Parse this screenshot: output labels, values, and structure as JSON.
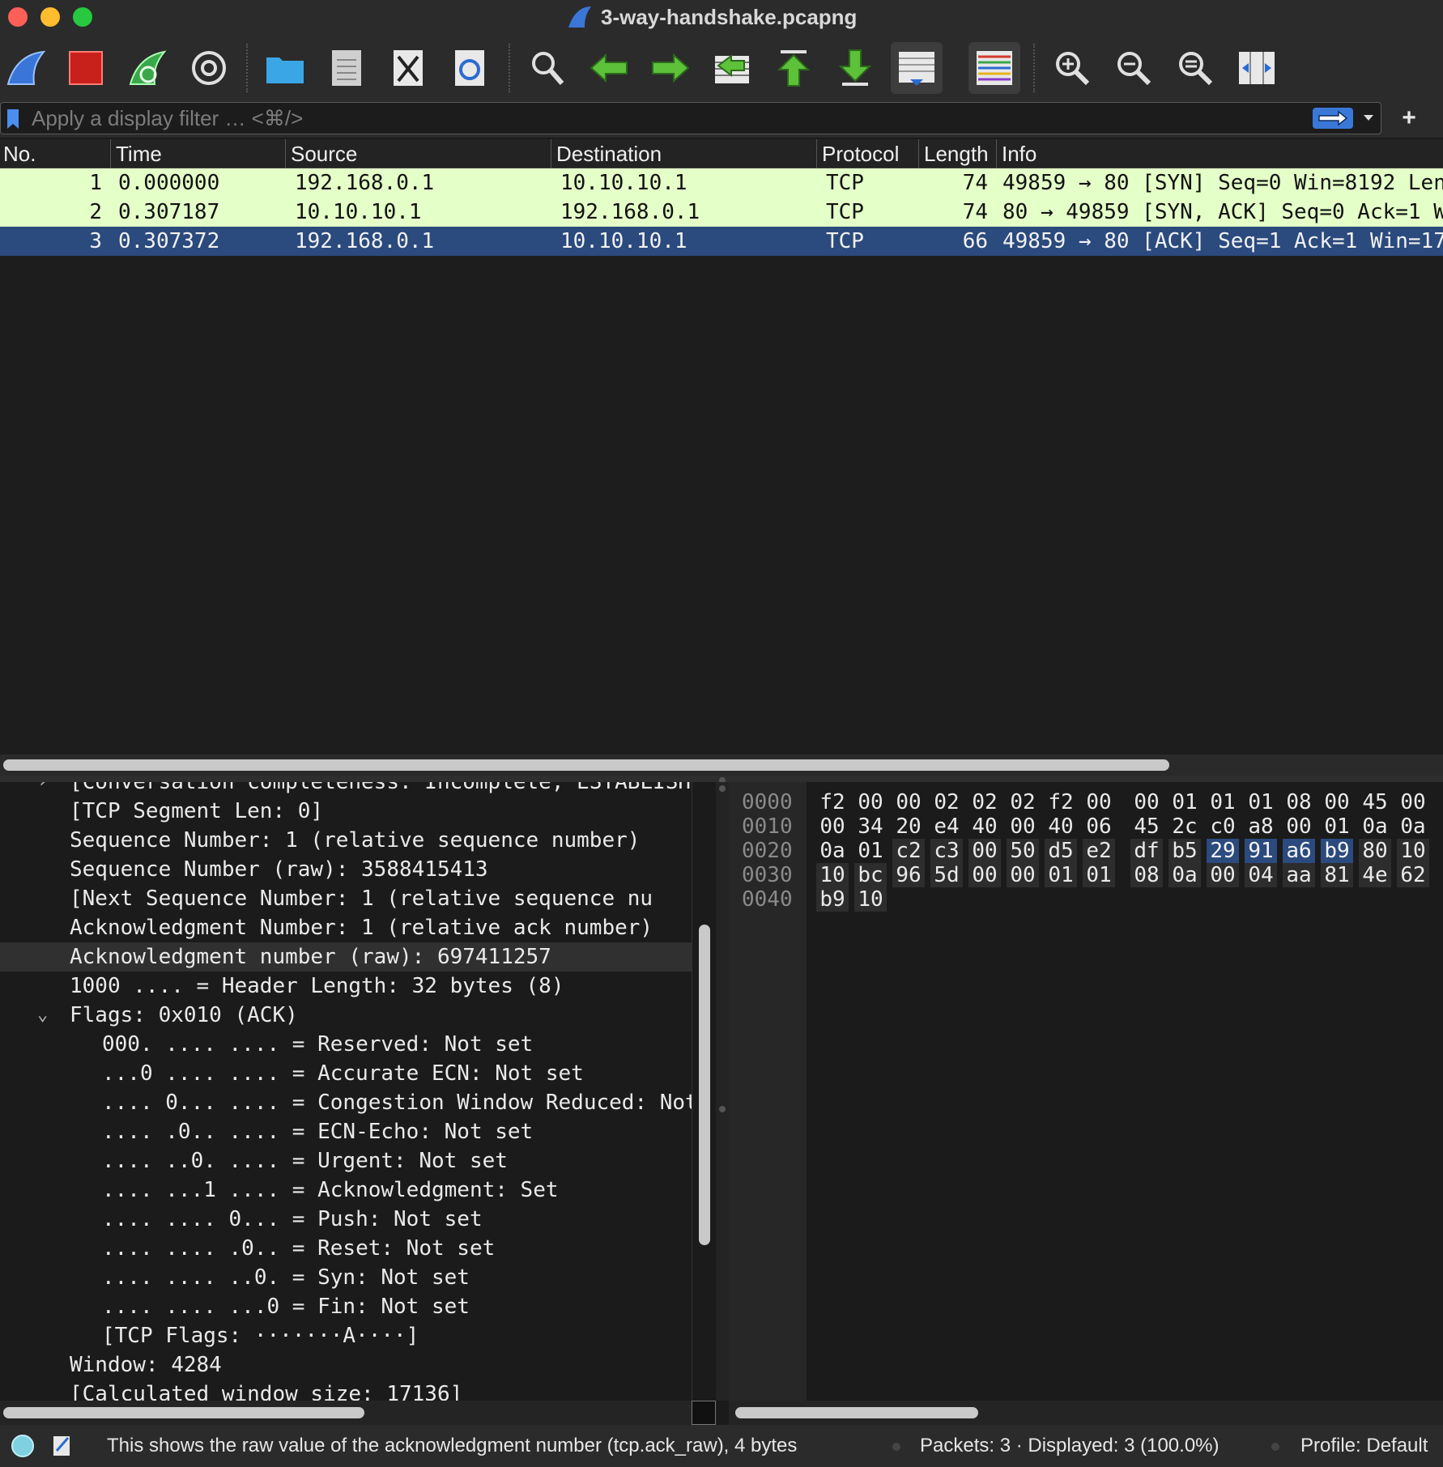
{
  "window": {
    "title": "3-way-handshake.pcapng",
    "traffic_colors": [
      "#fe5f57",
      "#febc2e",
      "#28c840"
    ]
  },
  "toolbar": {
    "buttons": [
      {
        "name": "start-capture",
        "icon": "shark-fin-icon"
      },
      {
        "name": "stop-capture",
        "icon": "stop-square-icon"
      },
      {
        "name": "restart-capture",
        "icon": "restart-fin-icon"
      },
      {
        "name": "capture-options",
        "icon": "gear-icon"
      },
      {
        "name": "open-file",
        "icon": "folder-icon"
      },
      {
        "name": "save-file",
        "icon": "binary-file-icon"
      },
      {
        "name": "close-file",
        "icon": "close-file-icon"
      },
      {
        "name": "reload-file",
        "icon": "reload-file-icon"
      },
      {
        "name": "find-packet",
        "icon": "magnifier-icon"
      },
      {
        "name": "go-back",
        "icon": "arrow-left-icon"
      },
      {
        "name": "go-forward",
        "icon": "arrow-right-icon"
      },
      {
        "name": "go-to-packet",
        "icon": "goto-packet-icon"
      },
      {
        "name": "go-first-packet",
        "icon": "arrow-up-bar-icon"
      },
      {
        "name": "go-last-packet",
        "icon": "arrow-down-bar-icon"
      },
      {
        "name": "auto-scroll",
        "icon": "auto-scroll-icon"
      },
      {
        "name": "colorize",
        "icon": "colorize-lines-icon"
      },
      {
        "name": "zoom-in",
        "icon": "zoom-in-icon"
      },
      {
        "name": "zoom-out",
        "icon": "zoom-out-icon"
      },
      {
        "name": "normal-size",
        "icon": "zoom-reset-icon"
      },
      {
        "name": "resize-columns",
        "icon": "resize-columns-icon"
      }
    ]
  },
  "filter": {
    "placeholder": "Apply a display filter … <⌘/>",
    "value": "",
    "plus_label": "+"
  },
  "packet_list": {
    "columns": [
      "No.",
      "Time",
      "Source",
      "Destination",
      "Protocol",
      "Length",
      "Info"
    ],
    "rows": [
      {
        "no": "1",
        "time": "0.000000",
        "source": "192.168.0.1",
        "destination": "10.10.10.1",
        "protocol": "TCP",
        "length": "74",
        "info": "49859 → 80 [SYN] Seq=0 Win=8192 Len"
      },
      {
        "no": "2",
        "time": "0.307187",
        "source": "10.10.10.1",
        "destination": "192.168.0.1",
        "protocol": "TCP",
        "length": "74",
        "info": "80 → 49859 [SYN, ACK] Seq=0 Ack=1 W"
      },
      {
        "no": "3",
        "time": "0.307372",
        "source": "192.168.0.1",
        "destination": "10.10.10.1",
        "protocol": "TCP",
        "length": "66",
        "info": "49859 → 80 [ACK] Seq=1 Ack=1 Win=17"
      }
    ],
    "selected_row": 3,
    "tcp_row_color": "#e4ffc7",
    "selected_color": "#2b4a7e"
  },
  "details": {
    "lines": [
      {
        "text": "[Conversation completeness: Incomplete, ESTABLISH",
        "indent": 1,
        "expander": "›"
      },
      {
        "text": "[TCP Segment Len: 0]",
        "indent": 1
      },
      {
        "text": "Sequence Number: 1    (relative sequence number)",
        "indent": 1
      },
      {
        "text": "Sequence Number (raw): 3588415413",
        "indent": 1
      },
      {
        "text": "[Next Sequence Number: 1    (relative sequence nu",
        "indent": 1
      },
      {
        "text": "Acknowledgment Number: 1    (relative ack number)",
        "indent": 1
      },
      {
        "text": "Acknowledgment number (raw): 697411257",
        "indent": 1,
        "selected": true
      },
      {
        "text": "1000 .... = Header Length: 32 bytes (8)",
        "indent": 1
      },
      {
        "text": "Flags: 0x010 (ACK)",
        "indent": 1,
        "expander": "⌄"
      },
      {
        "text": "000. .... .... = Reserved: Not set",
        "indent": 2
      },
      {
        "text": "...0 .... .... = Accurate ECN: Not set",
        "indent": 2
      },
      {
        "text": ".... 0... .... = Congestion Window Reduced: Not",
        "indent": 2
      },
      {
        "text": ".... .0.. .... = ECN-Echo: Not set",
        "indent": 2
      },
      {
        "text": ".... ..0. .... = Urgent: Not set",
        "indent": 2
      },
      {
        "text": ".... ...1 .... = Acknowledgment: Set",
        "indent": 2
      },
      {
        "text": ".... .... 0... = Push: Not set",
        "indent": 2
      },
      {
        "text": ".... .... .0.. = Reset: Not set",
        "indent": 2
      },
      {
        "text": ".... .... ..0. = Syn: Not set",
        "indent": 2
      },
      {
        "text": ".... .... ...0 = Fin: Not set",
        "indent": 2
      },
      {
        "text": "[TCP Flags: ·······A····]",
        "indent": 2
      },
      {
        "text": "Window: 4284",
        "indent": 1
      },
      {
        "text": "[Calculated window size: 17136]",
        "indent": 1
      }
    ]
  },
  "bytes": {
    "rows": [
      {
        "offset": "0000",
        "hex": [
          "f2",
          "00",
          "00",
          "02",
          "02",
          "02",
          "f2",
          "00",
          "00",
          "01",
          "01",
          "01",
          "08",
          "00",
          "45",
          "00"
        ]
      },
      {
        "offset": "0010",
        "hex": [
          "00",
          "34",
          "20",
          "e4",
          "40",
          "00",
          "40",
          "06",
          "45",
          "2c",
          "c0",
          "a8",
          "00",
          "01",
          "0a",
          "0a"
        ]
      },
      {
        "offset": "0020",
        "hex": [
          "0a",
          "01",
          "c2",
          "c3",
          "00",
          "50",
          "d5",
          "e2",
          "df",
          "b5",
          "29",
          "91",
          "a6",
          "b9",
          "80",
          "10"
        ]
      },
      {
        "offset": "0030",
        "hex": [
          "10",
          "bc",
          "96",
          "5d",
          "00",
          "00",
          "01",
          "01",
          "08",
          "0a",
          "00",
          "04",
          "aa",
          "81",
          "4e",
          "62"
        ]
      },
      {
        "offset": "0040",
        "hex": [
          "b9",
          "10"
        ]
      }
    ],
    "highlight_start": 42,
    "highlight_end": 45,
    "field_start": 34
  },
  "status": {
    "message": "This shows the raw value of the acknowledgment number (tcp.ack_raw), 4 bytes",
    "packets": "Packets: 3 · Displayed: 3 (100.0%)",
    "profile": "Profile: Default"
  }
}
